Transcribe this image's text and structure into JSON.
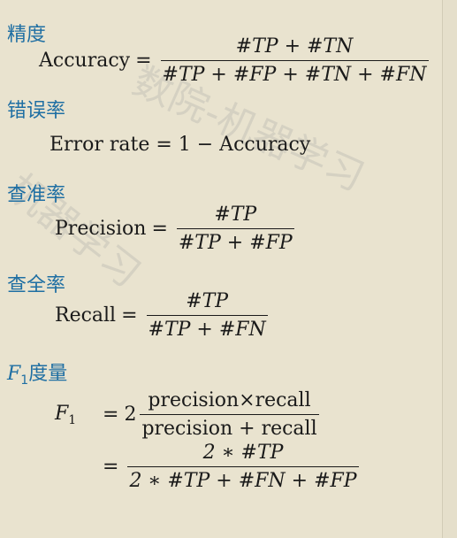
{
  "watermarks": [
    "数院-机器学习",
    "机器学习"
  ],
  "accuracy": {
    "heading": "精度",
    "lhs": "Accuracy",
    "eq": "=",
    "num": "#TP + #TN",
    "den": "#TP + #FP + #TN + #FN"
  },
  "error_rate": {
    "heading": "错误率",
    "formula": "Error rate = 1 − Accuracy"
  },
  "precision": {
    "heading": "查准率",
    "lhs": "Precision",
    "eq": "=",
    "num": "#TP",
    "den": "#TP + #FP"
  },
  "recall": {
    "heading": "查全率",
    "lhs": "Recall",
    "eq": "=",
    "num": "#TP",
    "den": "#TP + #FN"
  },
  "f1": {
    "heading_var": "F",
    "heading_sub": "1",
    "heading_text": "度量",
    "lhs_var": "F",
    "lhs_sub": "1",
    "eq": "=",
    "coef": "2",
    "num1": "precision×recall",
    "den1": "precision + recall",
    "eq2": "=",
    "num2": "2 ∗ #TP",
    "den2": "2 ∗ #TP + #FN + #FP"
  }
}
